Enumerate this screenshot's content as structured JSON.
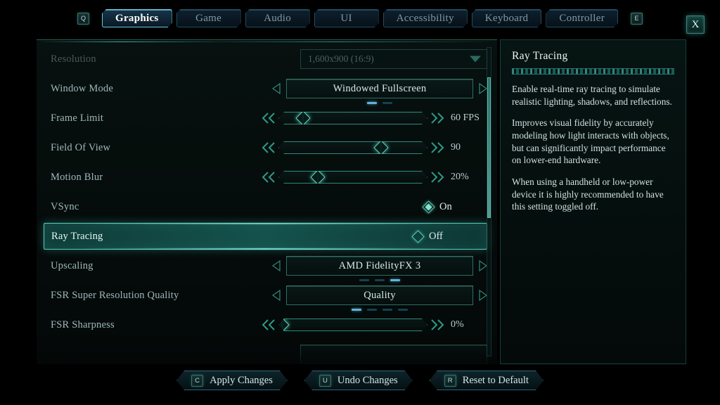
{
  "tabbar": {
    "prev_key": "Q",
    "next_key": "E",
    "close_label": "X",
    "tabs": [
      {
        "label": "Graphics",
        "active": true
      },
      {
        "label": "Game",
        "active": false
      },
      {
        "label": "Audio",
        "active": false
      },
      {
        "label": "UI",
        "active": false
      },
      {
        "label": "Accessibility",
        "active": false
      },
      {
        "label": "Keyboard",
        "active": false
      },
      {
        "label": "Controller",
        "active": false
      }
    ]
  },
  "settings": {
    "rows": [
      {
        "label": "Resolution",
        "type": "dropdown",
        "value": "1,600x900 (16:9)",
        "disabled": true
      },
      {
        "label": "Window Mode",
        "type": "stepper",
        "value": "Windowed Fullscreen",
        "dots": 2,
        "dot_active": 1
      },
      {
        "label": "Frame Limit",
        "type": "slider",
        "value": "60 FPS",
        "percent": 16
      },
      {
        "label": "Field Of View",
        "type": "slider",
        "value": "90",
        "percent": 69
      },
      {
        "label": "Motion Blur",
        "type": "slider",
        "value": "20%",
        "percent": 26
      },
      {
        "label": "VSync",
        "type": "toggle",
        "value": "On",
        "on": true
      },
      {
        "label": "Ray Tracing",
        "type": "toggle",
        "value": "Off",
        "on": false,
        "selected": true
      },
      {
        "label": "Upscaling",
        "type": "stepper",
        "value": "AMD FidelityFX 3",
        "dots": 3,
        "dot_active": 3
      },
      {
        "label": "FSR Super Resolution Quality",
        "type": "stepper",
        "value": "Quality",
        "dots": 4,
        "dot_active": 1
      },
      {
        "label": "FSR Sharpness",
        "type": "slider",
        "value": "0%",
        "percent": 2
      }
    ]
  },
  "info": {
    "title": "Ray Tracing",
    "paragraphs": [
      "Enable real-time ray tracing to simulate realistic lighting, shadows, and reflections.",
      "Improves visual fidelity by accurately modeling how light interacts with objects, but can significantly impact performance on lower-end hardware.",
      "When using a handheld or low-power device it is highly recommended to have this setting toggled off."
    ]
  },
  "actions": [
    {
      "key": "C",
      "label": "Apply Changes"
    },
    {
      "key": "U",
      "label": "Undo Changes"
    },
    {
      "key": "R",
      "label": "Reset to Default"
    }
  ],
  "colors": {
    "accent_teal": "#57cfc0",
    "accent_blue": "#5fb4d8",
    "panel_bg": "#07110f",
    "text_primary": "#dceeec",
    "text_muted": "#9fb8bb",
    "text_disabled": "#46595c"
  }
}
